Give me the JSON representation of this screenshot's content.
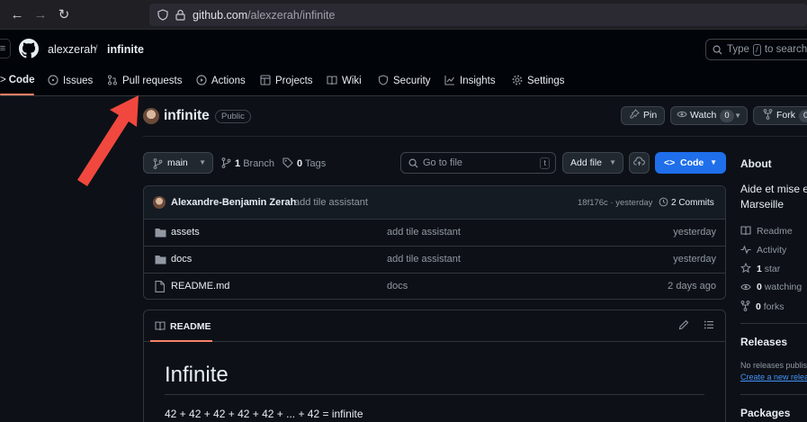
{
  "browser": {
    "url_domain": "github.com",
    "url_path": "/alexzerah/infinite"
  },
  "header": {
    "owner": "alexzerah",
    "separator": "/",
    "repo": "infinite",
    "search_prefix": "Type",
    "search_key": "/",
    "search_suffix": "to search"
  },
  "tabs": [
    {
      "label": "Code",
      "icon": "code-icon"
    },
    {
      "label": "Issues",
      "icon": "issue-icon"
    },
    {
      "label": "Pull requests",
      "icon": "pull-request-icon"
    },
    {
      "label": "Actions",
      "icon": "play-icon"
    },
    {
      "label": "Projects",
      "icon": "table-icon"
    },
    {
      "label": "Wiki",
      "icon": "book-icon"
    },
    {
      "label": "Security",
      "icon": "shield-icon"
    },
    {
      "label": "Insights",
      "icon": "graph-icon"
    },
    {
      "label": "Settings",
      "icon": "gear-icon"
    }
  ],
  "repo_header": {
    "name": "infinite",
    "visibility": "Public",
    "pin_label": "Pin",
    "watch_label": "Watch",
    "watch_count": "0",
    "fork_label": "Fork",
    "fork_count": "0"
  },
  "toolbar": {
    "branch": "main",
    "branch_count": "1",
    "branch_word": "Branch",
    "tag_count": "0",
    "tag_word": "Tags",
    "goto_placeholder": "Go to file",
    "goto_key": "t",
    "add_file_label": "Add file",
    "code_label": "Code"
  },
  "latest_commit": {
    "author": "Alexandre-Benjamin Zerah",
    "message": "add tile assistant",
    "hash_time": "18f176c · yesterday",
    "commits_label": "2 Commits"
  },
  "files": [
    {
      "name": "assets",
      "type": "folder",
      "message": "add tile assistant",
      "date": "yesterday"
    },
    {
      "name": "docs",
      "type": "folder",
      "message": "add tile assistant",
      "date": "yesterday"
    },
    {
      "name": "README.md",
      "type": "file",
      "message": "docs",
      "date": "2 days ago"
    }
  ],
  "readme": {
    "tab_label": "README",
    "heading": "Infinite",
    "paragraph": "42 + 42 + 42 + 42 + 42 + ... + 42 = infinite"
  },
  "sidebar": {
    "about_title": "About",
    "description_line1": "Aide et mise e",
    "description_line2": "Marseille",
    "readme_link": "Readme",
    "activity_link": "Activity",
    "stars_count": "1",
    "stars_word": "star",
    "watching_count": "0",
    "watching_word": "watching",
    "forks_count": "0",
    "forks_word": "forks",
    "releases_title": "Releases",
    "releases_empty": "No releases publis",
    "releases_create": "Create a new relea",
    "packages_title": "Packages"
  },
  "colors": {
    "accent_blue": "#1f6feb",
    "tab_underline": "#f78166",
    "annotation_arrow": "#f0483e"
  }
}
